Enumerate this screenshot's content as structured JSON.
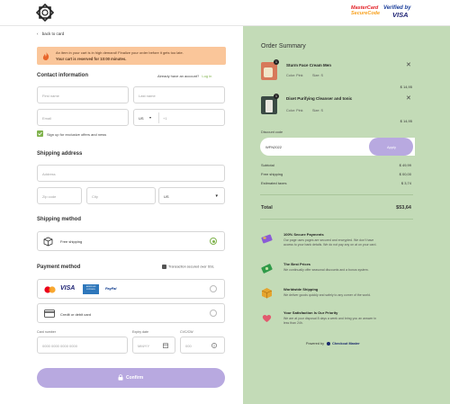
{
  "header": {
    "mastercard_line1": "MasterCard",
    "mastercard_line2": "SecureCode",
    "visa_line1": "Verified by",
    "visa_line2": "VISA"
  },
  "nav": {
    "back_label": "back to card"
  },
  "alert": {
    "line1": "An item in your cart is in high demand! Finalize your order before it gets too late.",
    "line2": "Your cart is reserved for 10:00 minutes."
  },
  "contact": {
    "title": "Contact information",
    "have_account": "Already have an account?",
    "login": "Log in",
    "first_name_ph": "First name",
    "last_name_ph": "Last name",
    "email_ph": "Email",
    "country_code": "US",
    "phone_prefix": "+1",
    "signup_label": "Sign up for exclusive offers and news",
    "signup_checked": true
  },
  "shipping_address": {
    "title": "Shipping address",
    "address_ph": "Address",
    "zip_ph": "Zip code",
    "city_ph": "City",
    "country": "US"
  },
  "shipping_method": {
    "title": "Shipping method",
    "option_label": "Free shipping",
    "selected": true
  },
  "payment": {
    "title": "Payment method",
    "secure_note": "Transaction secured over SSL",
    "card_brands": [
      "Mastercard",
      "VISA",
      "AMERICAN EXPRESS",
      "PayPal"
    ],
    "card_option_label": "Credit or debit card",
    "card_number_label": "Card number",
    "card_number_ph": "0000 0000 0000 0000",
    "expiry_label": "Expiry date",
    "expiry_ph": "MM/YY",
    "cvc_label": "CVC/CW",
    "cvc_ph": "000"
  },
  "confirm_label": "Confirm",
  "summary": {
    "title": "Order Summary",
    "items": [
      {
        "name": "Sturm Face Cream Men",
        "color": "Color: Pink",
        "size": "Size: S",
        "price": "$ 14,95",
        "qty": "1"
      },
      {
        "name": "Dixet Purifying Cleanser and tonic",
        "color": "Color: Pink",
        "size": "Size: S",
        "price": "$ 14,95",
        "qty": "1"
      }
    ],
    "discount_label": "Discount code",
    "discount_value": "WFN2022",
    "apply_label": "Apply",
    "subtotal_label": "Subtotal",
    "subtotal": "$ 49,99",
    "shipping_label": "Free shipping",
    "shipping": "$ 00,00",
    "taxes_label": "Estimated taxes",
    "taxes": "$ 3,74",
    "total_label": "Total",
    "total": "$53,64"
  },
  "features": [
    {
      "title": "100% Secure Payments",
      "desc": "Our page uses pages are secured and encrypted. We don't have access to your bank details. We do not pay any on at on your card.",
      "icon": "card-icon"
    },
    {
      "title": "The Best Prices",
      "desc": "We continually offer seasonal discounts and a bonus system.",
      "icon": "money-icon"
    },
    {
      "title": "Worldwide Shipping",
      "desc": "We deliver goods quickly and safely to any corner of the world.",
      "icon": "box-icon"
    },
    {
      "title": "Your Satisfaction Is Our Priority",
      "desc": "We are at your disposal 8 days a week and bring you an answer in less than 24h.",
      "icon": "heart-icon"
    }
  ],
  "powered_by": {
    "prefix": "Powered by",
    "brand": "Checkout Master"
  },
  "colors": {
    "accent_green": "#7fb24c",
    "panel_bg": "#c3dbb7",
    "button_purple": "#b8a9e0",
    "alert_bg": "#fac69a"
  }
}
